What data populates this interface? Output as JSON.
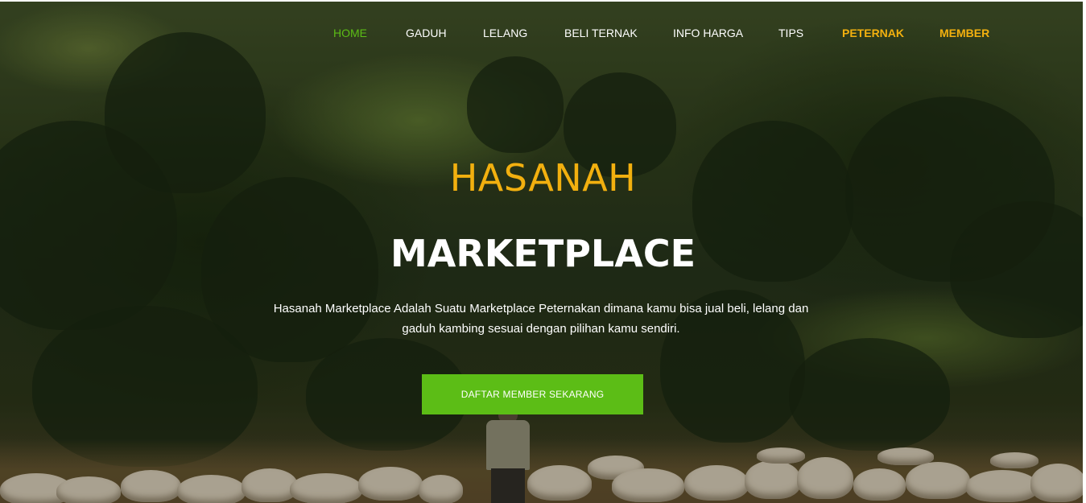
{
  "nav": {
    "items": [
      {
        "label": "HOME"
      },
      {
        "label": "GADUH"
      },
      {
        "label": "LELANG"
      },
      {
        "label": "BELI TERNAK"
      },
      {
        "label": "INFO HARGA"
      },
      {
        "label": "TIPS"
      },
      {
        "label": "PETERNAK"
      },
      {
        "label": "MEMBER"
      }
    ],
    "active": "HOME"
  },
  "hero": {
    "title": "HASANAH",
    "subtitle": "MARKETPLACE",
    "description": "Hasanah Marketplace Adalah Suatu Marketplace Peternakan dimana kamu bisa jual beli, lelang dan gaduh kambing sesuai dengan pilihan kamu sendiri.",
    "cta_label": "DAFTAR MEMBER SEKARANG"
  },
  "colors": {
    "accent_green": "#5cbd16",
    "accent_yellow": "#f2b00f",
    "text_white": "#ffffff"
  }
}
